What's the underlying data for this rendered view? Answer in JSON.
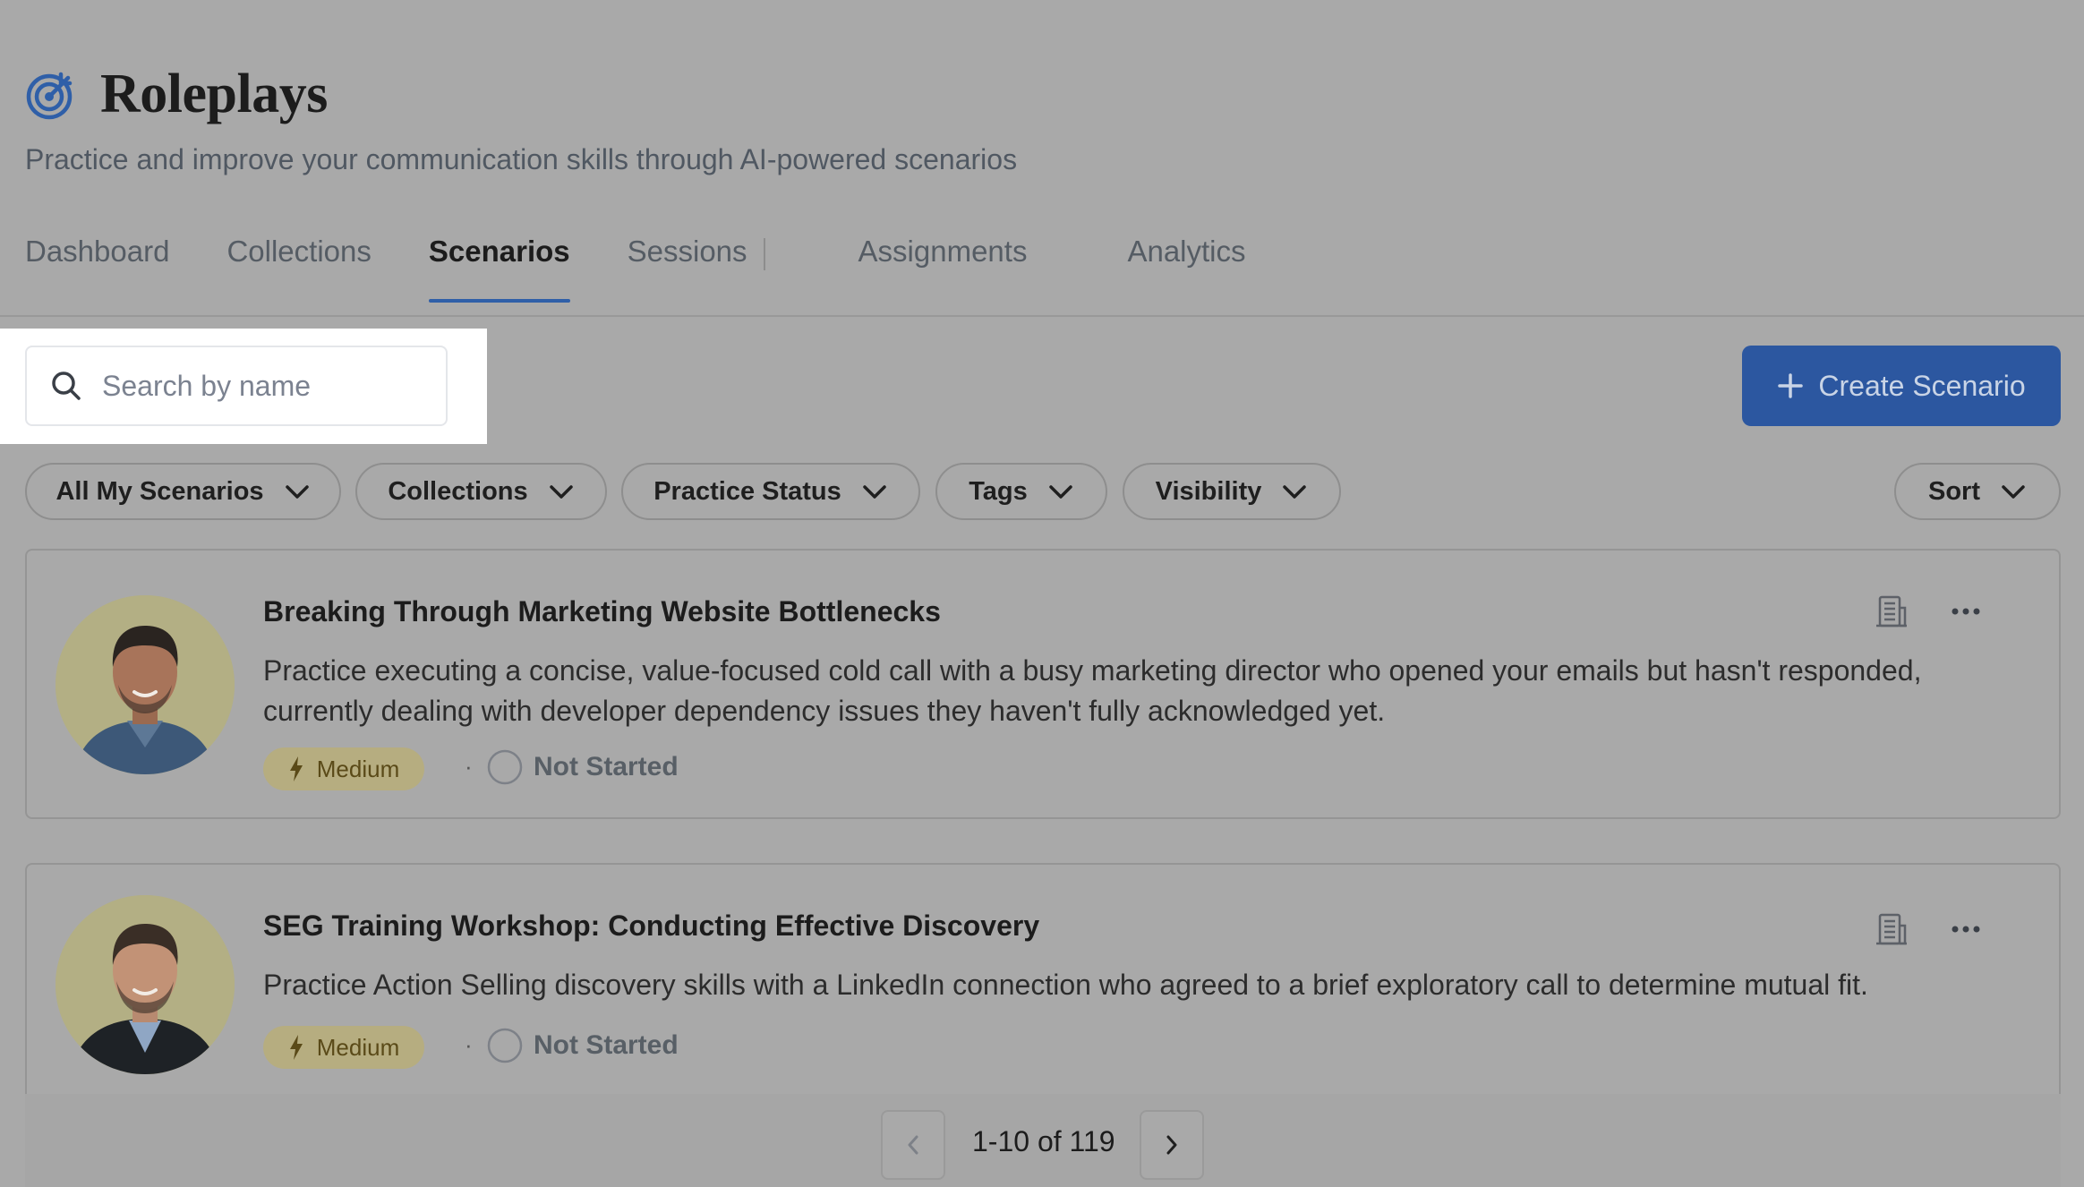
{
  "header": {
    "title": "Roleplays",
    "subtitle": "Practice and improve your communication skills through AI-powered scenarios"
  },
  "tabs": [
    {
      "label": "Dashboard",
      "active": false
    },
    {
      "label": "Collections",
      "active": false
    },
    {
      "label": "Scenarios",
      "active": true
    },
    {
      "label": "Sessions",
      "active": false
    },
    {
      "label": "Assignments",
      "active": false
    },
    {
      "label": "Analytics",
      "active": false
    }
  ],
  "search": {
    "placeholder": "Search by name",
    "value": ""
  },
  "toolbar": {
    "create_label": "Create Scenario"
  },
  "filters": {
    "all_my_scenarios": "All My Scenarios",
    "collections": "Collections",
    "practice_status": "Practice Status",
    "tags": "Tags",
    "visibility": "Visibility",
    "sort": "Sort"
  },
  "scenarios": [
    {
      "title": "Breaking Through Marketing Website Bottlenecks",
      "description": "Practice executing a concise, value-focused cold call with a busy marketing director who opened your emails but hasn't responded, currently dealing with developer dependency issues they haven't fully acknowledged yet.",
      "difficulty": "Medium",
      "separator": "·",
      "status": "Not Started"
    },
    {
      "title": "SEG Training Workshop: Conducting Effective Discovery",
      "description": "Practice Action Selling discovery skills with a LinkedIn connection who agreed to a brief exploratory call to determine mutual fit.",
      "difficulty": "Medium",
      "separator": "·",
      "status": "Not Started"
    }
  ],
  "pagination": {
    "range": "1-10 of 119"
  },
  "colors": {
    "accent": "#2c57a0",
    "tab_indicator": "#2f5fa8",
    "badge_bg": "#b6ad80"
  },
  "icons": {
    "logo": "target-arrow-icon",
    "search": "search-icon",
    "create": "plus-icon",
    "dropdown": "chevron-down-icon",
    "company": "building-icon",
    "more": "more-horizontal-icon",
    "difficulty": "lightning-icon",
    "status": "circle-outline-icon",
    "prev": "chevron-left-icon",
    "next": "chevron-right-icon"
  }
}
